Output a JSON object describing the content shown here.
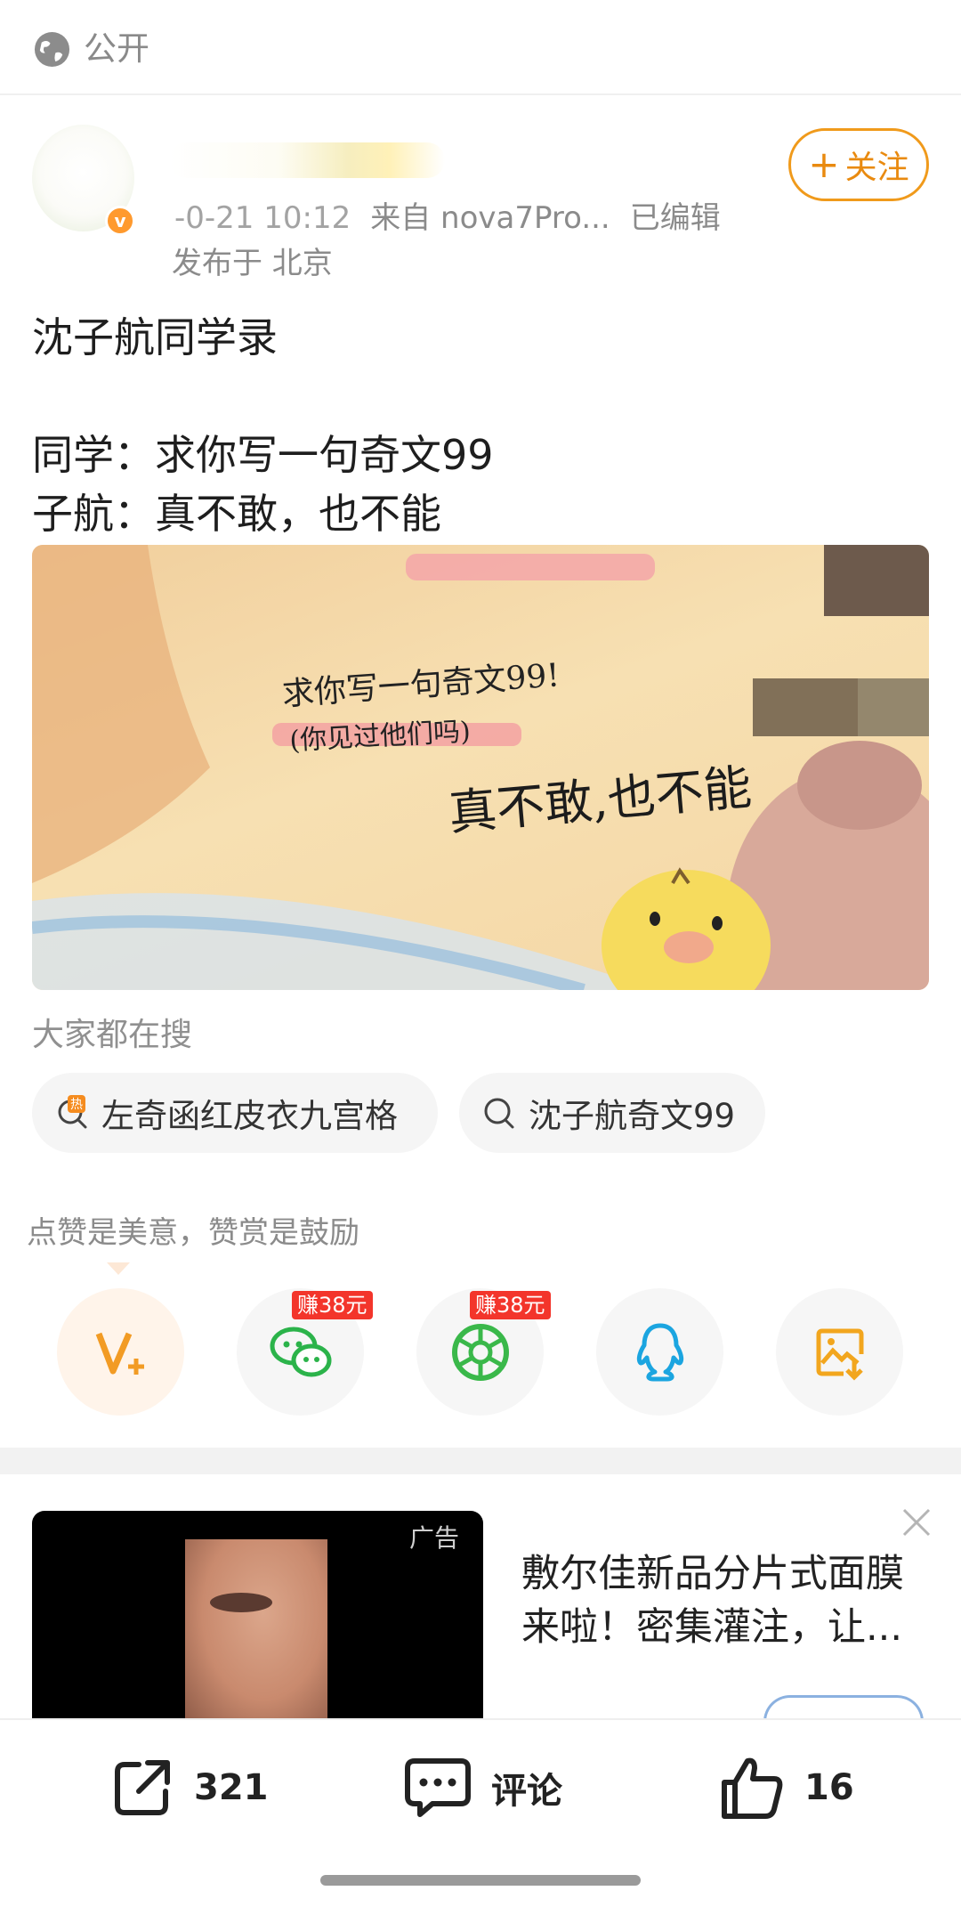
{
  "topbar": {
    "visibility_label": "公开",
    "icon": "globe-icon"
  },
  "post": {
    "meta": {
      "time": "-0-21 10:12",
      "source": "来自 nova7Pro...",
      "edited": "已编辑"
    },
    "location": "发布于 北京",
    "follow_label": "关注",
    "text": "沈子航同学录\n\n同学：求你写一句奇文99\n子航：真不敢，也不能",
    "image_handwriting": {
      "line1": "求你写一句奇文99!",
      "line2": "(你见过他们吗)",
      "line3": "真不敢,也不能"
    }
  },
  "search": {
    "title": "大家都在搜",
    "chips": [
      {
        "label": "左奇函红皮衣九宫格",
        "icon": "hot-search-icon"
      },
      {
        "label": "沈子航奇文99",
        "icon": "search-icon"
      }
    ]
  },
  "reward": {
    "text": "点赞是美意，赞赏是鼓励"
  },
  "share": {
    "items": [
      {
        "name": "reward-v-plus",
        "icon": "v-plus-icon",
        "color": "#f29b24"
      },
      {
        "name": "wechat",
        "icon": "wechat-icon",
        "color": "#2bb34a",
        "badge": "赚38元"
      },
      {
        "name": "moments",
        "icon": "moments-icon",
        "color": "#3ab84a",
        "badge": "赚38元"
      },
      {
        "name": "qq",
        "icon": "qq-icon",
        "color": "#1ba5e0"
      },
      {
        "name": "save-image",
        "icon": "save-image-icon",
        "color": "#f2a61e"
      }
    ]
  },
  "ad": {
    "label": "广告",
    "text": "敷尔佳新品分片式面膜来啦！密集灌注，让..."
  },
  "bottom_bar": {
    "repost_count": "321",
    "comment_label": "评论",
    "like_count": "16"
  },
  "colors": {
    "accent": "#f09a1b",
    "badge_red": "#f3352b"
  }
}
